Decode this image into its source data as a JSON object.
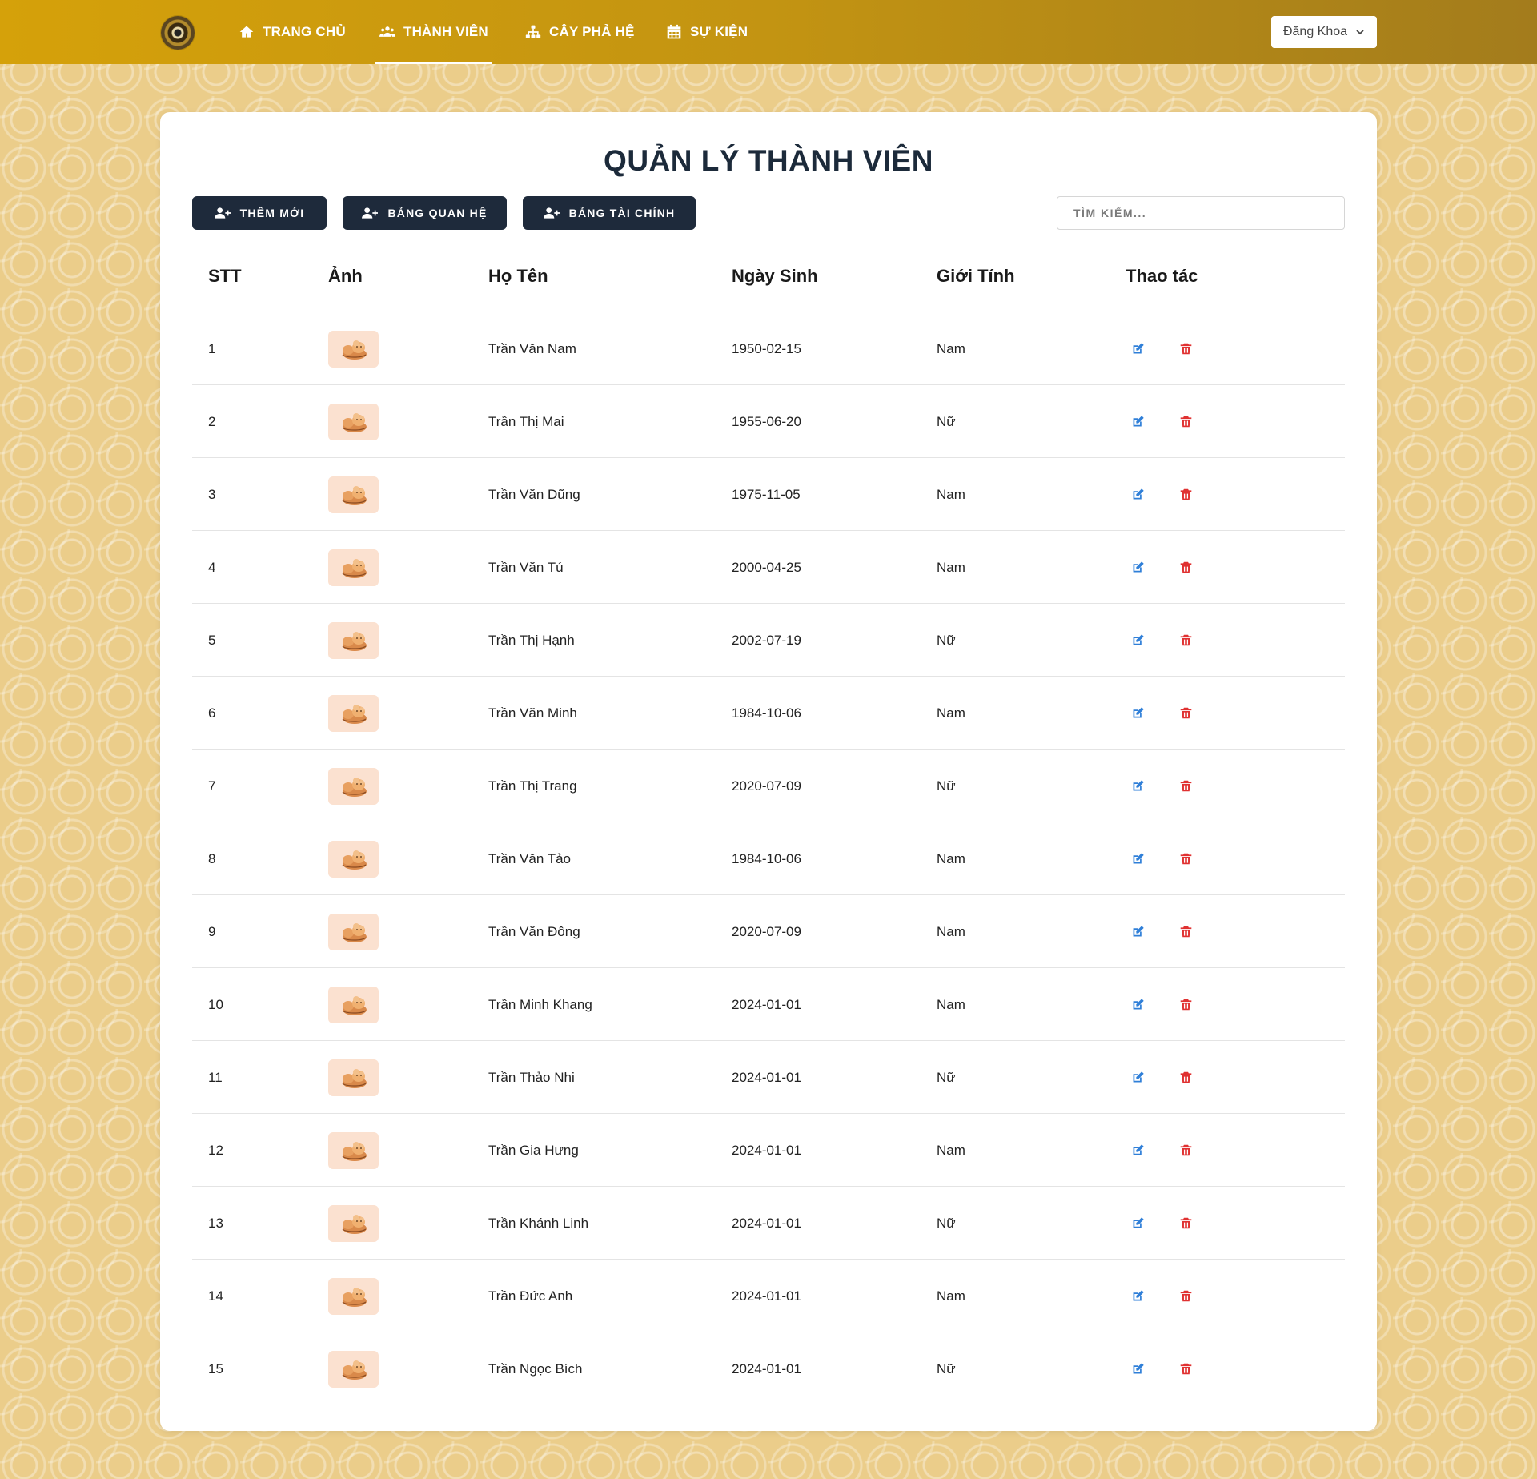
{
  "nav": {
    "items": [
      {
        "label": "TRANG CHỦ",
        "icon": "home-icon"
      },
      {
        "label": "THÀNH VIÊN",
        "icon": "users-icon",
        "active": true
      },
      {
        "label": "CÂY PHẢ HỆ",
        "icon": "sitemap-icon"
      },
      {
        "label": "SỰ KIỆN",
        "icon": "calendar-icon"
      }
    ],
    "user": "Đăng Khoa"
  },
  "page": {
    "title": "QUẢN LÝ THÀNH VIÊN",
    "buttons": {
      "add": "THÊM MỚI",
      "relations": "BẢNG QUAN HỆ",
      "finance": "BẢNG TÀI CHÍNH"
    },
    "search_placeholder": "TÌM KIẾM..."
  },
  "table": {
    "headers": {
      "stt": "STT",
      "photo": "Ảnh",
      "name": "Họ Tên",
      "dob": "Ngày Sinh",
      "gender": "Giới Tính",
      "actions": "Thao tác"
    },
    "rows": [
      {
        "stt": "1",
        "name": "Trần Văn Nam",
        "dob": "1950-02-15",
        "gender": "Nam"
      },
      {
        "stt": "2",
        "name": "Trần Thị Mai",
        "dob": "1955-06-20",
        "gender": "Nữ"
      },
      {
        "stt": "3",
        "name": "Trần Văn Dũng",
        "dob": "1975-11-05",
        "gender": "Nam"
      },
      {
        "stt": "4",
        "name": "Trần Văn Tú",
        "dob": "2000-04-25",
        "gender": "Nam"
      },
      {
        "stt": "5",
        "name": "Trần Thị Hạnh",
        "dob": "2002-07-19",
        "gender": "Nữ"
      },
      {
        "stt": "6",
        "name": "Trần Văn Minh",
        "dob": "1984-10-06",
        "gender": "Nam"
      },
      {
        "stt": "7",
        "name": "Trần Thị Trang",
        "dob": "2020-07-09",
        "gender": "Nữ"
      },
      {
        "stt": "8",
        "name": "Trần Văn Tảo",
        "dob": "1984-10-06",
        "gender": "Nam"
      },
      {
        "stt": "9",
        "name": "Trần Văn Đông",
        "dob": "2020-07-09",
        "gender": "Nam"
      },
      {
        "stt": "10",
        "name": "Trần Minh Khang",
        "dob": "2024-01-01",
        "gender": "Nam"
      },
      {
        "stt": "11",
        "name": "Trần Thảo Nhi",
        "dob": "2024-01-01",
        "gender": "Nữ"
      },
      {
        "stt": "12",
        "name": "Trần Gia Hưng",
        "dob": "2024-01-01",
        "gender": "Nam"
      },
      {
        "stt": "13",
        "name": "Trần Khánh Linh",
        "dob": "2024-01-01",
        "gender": "Nữ"
      },
      {
        "stt": "14",
        "name": "Trần Đức Anh",
        "dob": "2024-01-01",
        "gender": "Nam"
      },
      {
        "stt": "15",
        "name": "Trần Ngọc Bích",
        "dob": "2024-01-01",
        "gender": "Nữ"
      }
    ]
  },
  "colors": {
    "nav_gradient_start": "#d5a10a",
    "nav_gradient_end": "#a37c1c",
    "button_dark": "#1e2a3b",
    "edit_icon": "#2f7fd8",
    "delete_icon": "#e03131",
    "avatar_bg": "#fbe1d0"
  }
}
